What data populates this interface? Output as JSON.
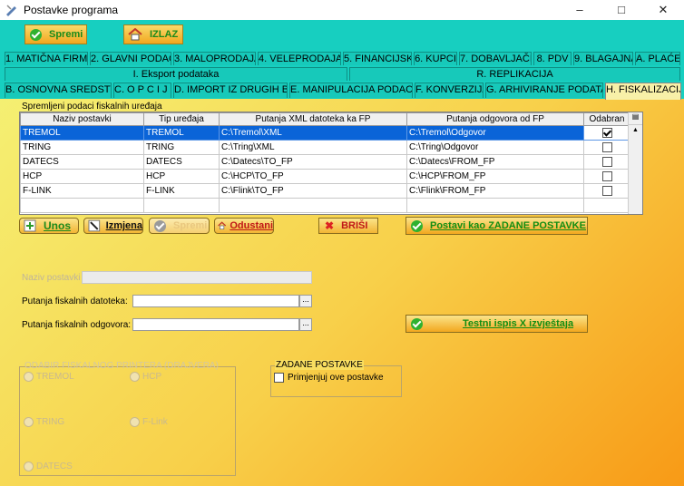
{
  "window": {
    "title": "Postavke programa"
  },
  "toolbar": {
    "save_label": "Spremi",
    "exit_label": "IZLAZ"
  },
  "tabs_row1": [
    {
      "label": "1. MATIČNA FIRMA"
    },
    {
      "label": "2. GLAVNI PODACI"
    },
    {
      "label": "3. MALOPRODAJA"
    },
    {
      "label": "4. VELEPRODAJA"
    },
    {
      "label": "5. FINANCIJSKO"
    },
    {
      "label": "6. KUPCI"
    },
    {
      "label": "7. DOBAVLJAČI"
    },
    {
      "label": "8. PDV"
    },
    {
      "label": "9. BLAGAJNA"
    },
    {
      "label": "A. PLAĆE"
    }
  ],
  "tabs_row2": [
    {
      "label": "I. Eksport podataka"
    },
    {
      "label": "R. REPLIKACIJA"
    }
  ],
  "tabs_row3": [
    {
      "label": "B. OSNOVNA SREDSTVA"
    },
    {
      "label": "C. O P C I J E"
    },
    {
      "label": "D. IMPORT IZ DRUGIH BAZA"
    },
    {
      "label": "E. MANIPULACIJA PODACIMA"
    },
    {
      "label": "F. KONVERZIJA"
    },
    {
      "label": "G. ARHIVIRANJE PODATAKA"
    },
    {
      "label": "H. FISKALIZACIJA"
    }
  ],
  "grid": {
    "caption": "Spremljeni podaci fiskalnih uređaja",
    "columns": [
      "Naziv postavki",
      "Tip uređaja",
      "Putanja XML datoteka ka FP",
      "Putanja odgovora od FP",
      "Odabran"
    ],
    "rows": [
      {
        "naziv": "TREMOL",
        "tip": "TREMOL",
        "xml": "C:\\Tremol\\XML",
        "odgovor": "C:\\Tremol\\Odgovor",
        "odabran": true
      },
      {
        "naziv": "TRING",
        "tip": "TRING",
        "xml": "C:\\Tring\\XML",
        "odgovor": "C:\\Tring\\Odgovor",
        "odabran": false
      },
      {
        "naziv": "DATECS",
        "tip": "DATECS",
        "xml": "C:\\Datecs\\TO_FP",
        "odgovor": "C:\\Datecs\\FROM_FP",
        "odabran": false
      },
      {
        "naziv": "HCP",
        "tip": "HCP",
        "xml": "C:\\HCP\\TO_FP",
        "odgovor": "C:\\HCP\\FROM_FP",
        "odabran": false
      },
      {
        "naziv": "F-LINK",
        "tip": "F-LINK",
        "xml": "C:\\Flink\\TO_FP",
        "odgovor": "C:\\Flink\\FROM_FP",
        "odabran": false
      }
    ]
  },
  "actions": {
    "unos": "Unos",
    "izmjena": "Izmjena",
    "spremi": "Spremi",
    "odustani": "Odustani",
    "brisi": "BRIŠI",
    "zadane": "Postavi kao ZADANE POSTAVKE",
    "testni": "Testni ispis X izvještaja"
  },
  "form": {
    "naziv_label": "Naziv postavki",
    "putanja_dat_label": "Putanja fiskalnih datoteka:",
    "putanja_odg_label": "Putanja fiskalnih odgovora:",
    "browse": "..."
  },
  "printers_group": {
    "title": "ODABIR FISKALNOG PRINTERA (DRAJVERA)",
    "options": [
      "TREMOL",
      "HCP",
      "TRING",
      "F-Link",
      "DATECS"
    ]
  },
  "defaults_group": {
    "title": "ZADANE POSTAVKE",
    "checkbox_label": "Primjenjuj ove postavke",
    "checked": false
  }
}
